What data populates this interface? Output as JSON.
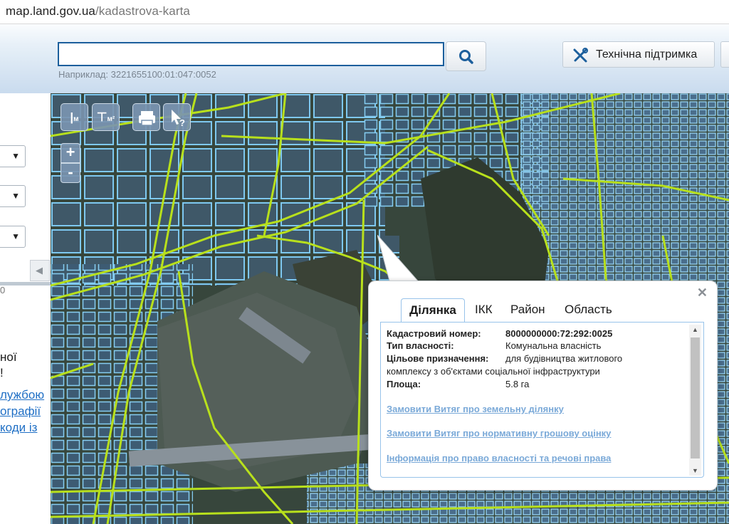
{
  "browser": {
    "url_host": "map.land.gov.ua",
    "url_path": "/kadastrova-karta"
  },
  "header": {
    "search_placeholder": "",
    "search_hint": "Наприклад: 3221655100:01:047:0052",
    "search_icon": "search-icon",
    "support_label": "Технічна підтримка",
    "support_icon": "tools-icon"
  },
  "left_panel": {
    "selects": [
      "",
      "",
      ""
    ],
    "number_fragment": "0",
    "text_fragments": [
      "ної",
      "!"
    ],
    "link_fragments": [
      "лужбою",
      "ографії",
      "коди  із"
    ]
  },
  "map_tools": {
    "measure_line": "м",
    "measure_area": "м²",
    "print_icon": "printer-icon",
    "identify_icon": "pointer-help-icon",
    "zoom_in": "+",
    "zoom_out": "-"
  },
  "popup": {
    "tabs": [
      "Ділянка",
      "ІКК",
      "Район",
      "Область"
    ],
    "active_tab": "Ділянка",
    "fields": [
      {
        "label": "Кадастровий номер:",
        "value": "8000000000:72:292:0025"
      },
      {
        "label": "Тип власності:",
        "value": "Комунальна власність"
      },
      {
        "label": "Цільове призначення:",
        "value": "для будівництва житлового"
      },
      {
        "label": "",
        "value": "комплексу з об'єктами соціальної інфраструктури"
      },
      {
        "label": "Площа:",
        "value": "5.8 га"
      }
    ],
    "links": [
      "Замовити Витяг про земельну ділянку",
      "Замовити Витяг про нормативну грошову оцінку",
      "Інформація про право власності та речові права"
    ]
  },
  "colors": {
    "parcel_outline": "#7ec8f0",
    "road_line": "#b8e01c",
    "accent": "#1c5f9c"
  }
}
